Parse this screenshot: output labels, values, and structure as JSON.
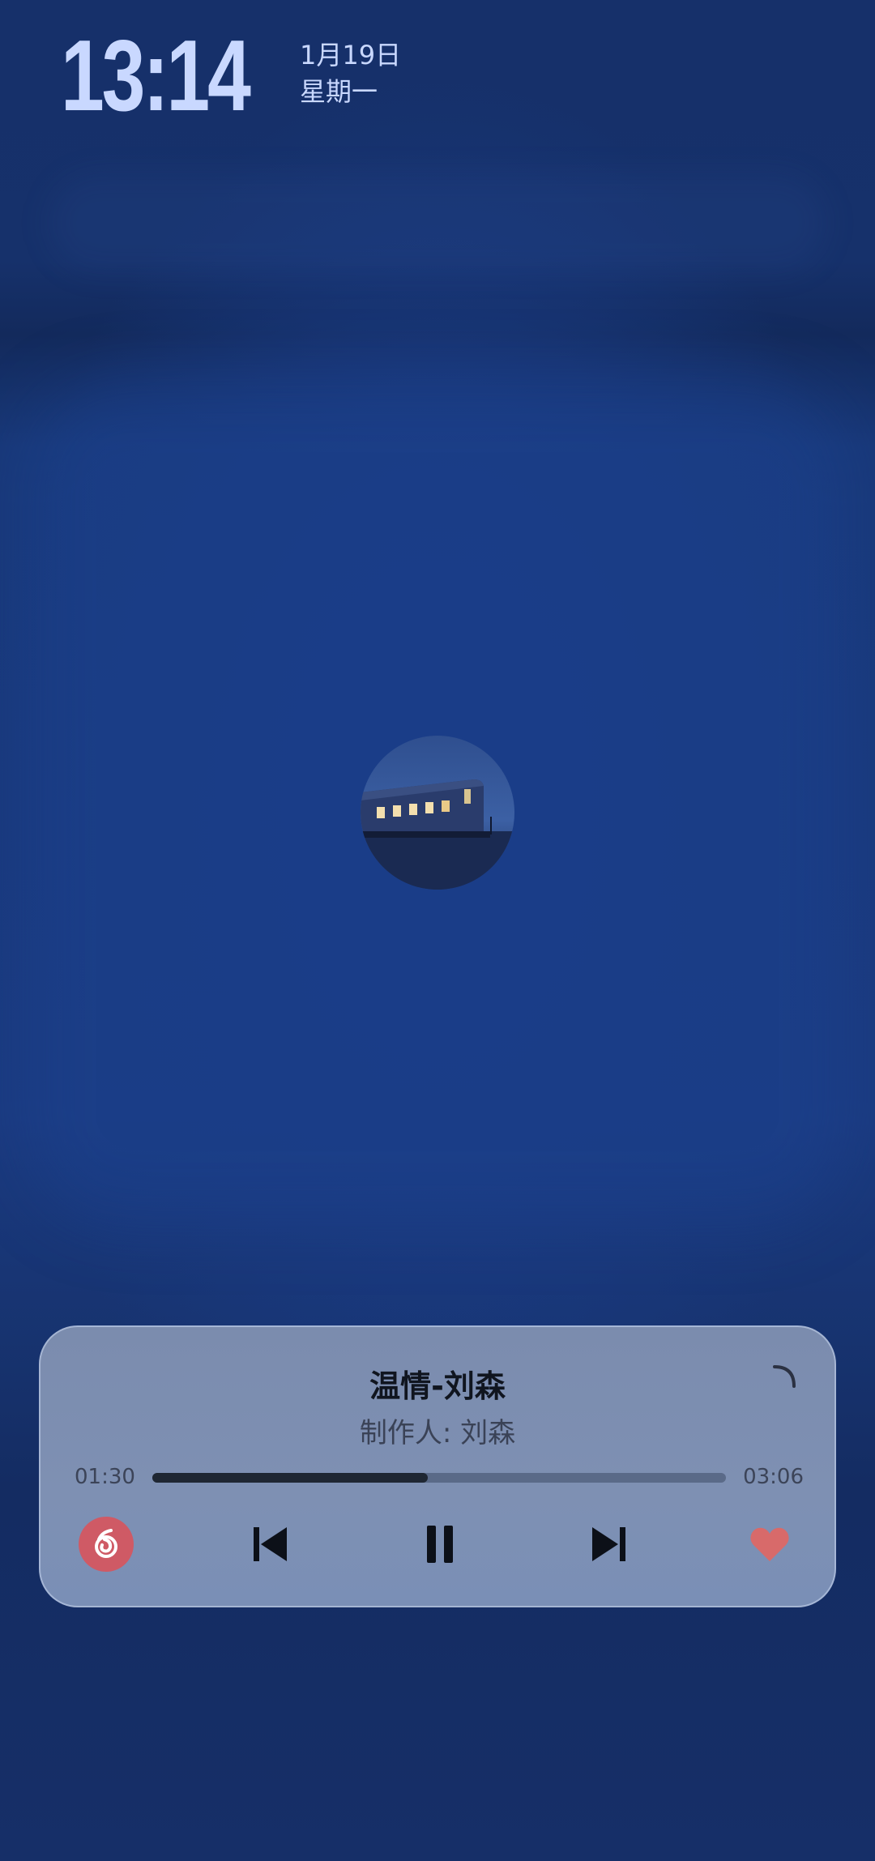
{
  "status": {
    "time": "13:14",
    "date": "1月19日",
    "weekday": "星期一"
  },
  "player": {
    "title": "温情-刘森",
    "artist": "制作人: 刘森",
    "elapsed": "01:30",
    "duration": "03:06",
    "progress_fraction": 0.48,
    "controls": {
      "app_icon": "netease-music-icon",
      "previous_icon": "skip-previous-icon",
      "play_pause_icon": "pause-icon",
      "next_icon": "skip-next-icon",
      "like_icon": "heart-icon"
    },
    "colors": {
      "like": "#d86a6a",
      "app_badge": "#cf5a65"
    }
  }
}
